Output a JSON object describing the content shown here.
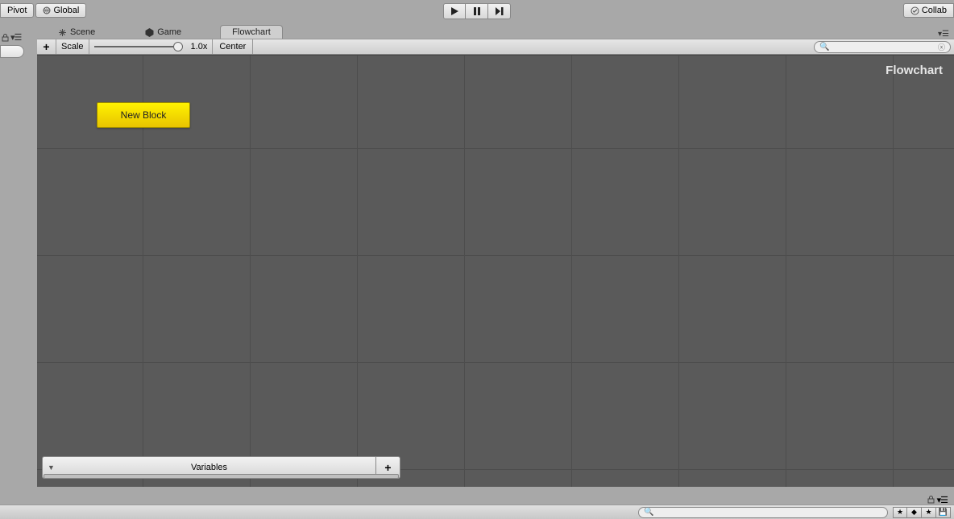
{
  "toolbar": {
    "pivot_label": "Pivot",
    "global_label": "Global",
    "collab_label": "Collab"
  },
  "tabs": {
    "scene": "Scene",
    "game": "Game",
    "flowchart": "Flowchart"
  },
  "subtoolbar": {
    "add": "+",
    "scale_label": "Scale",
    "scale_value": "1.0x",
    "center_label": "Center"
  },
  "canvas": {
    "title": "Flowchart",
    "block_label": "New Block"
  },
  "variables": {
    "label": "Variables",
    "add": "+"
  }
}
